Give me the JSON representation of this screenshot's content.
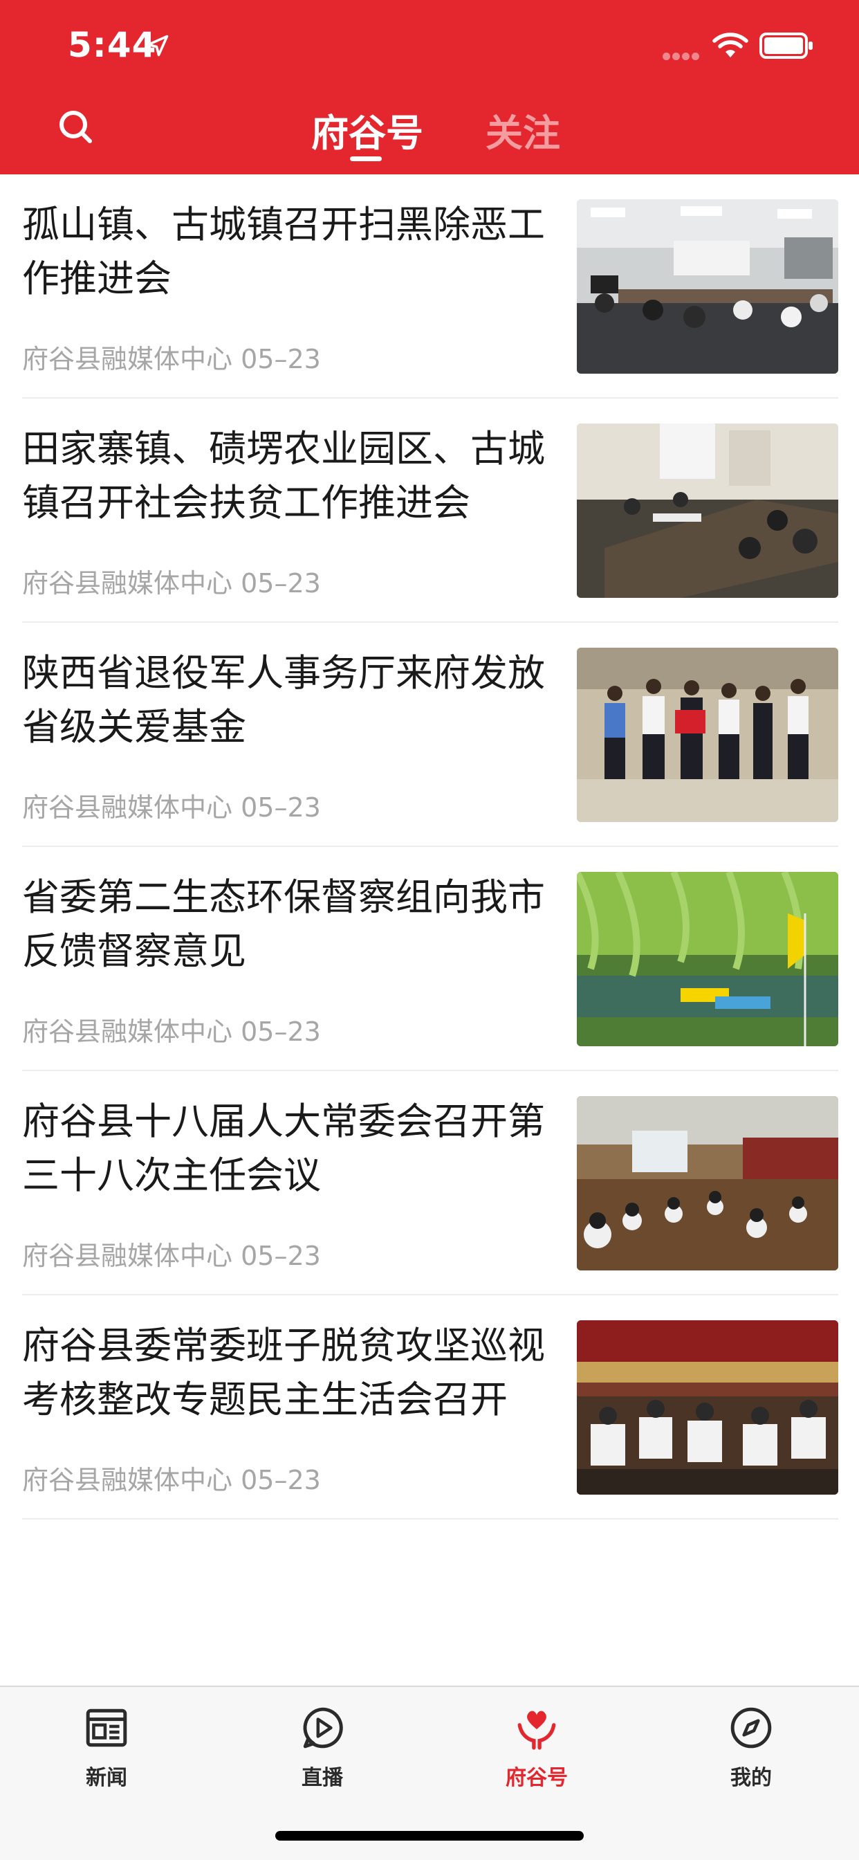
{
  "status_bar": {
    "time": "5:44"
  },
  "header": {
    "tabs": [
      {
        "label": "府谷号",
        "active": true
      },
      {
        "label": "关注",
        "active": false
      }
    ]
  },
  "news": [
    {
      "title": "孤山镇、古城镇召开扫黑除恶工作推进会",
      "source": "府谷县融媒体中心",
      "date": "05–23",
      "thumb": "meeting-room-photo"
    },
    {
      "title": "田家寨镇、碛塄农业园区、古城镇召开社会扶贫工作推进会",
      "source": "府谷县融媒体中心",
      "date": "05–23",
      "thumb": "meeting-table-photo"
    },
    {
      "title": "陕西省退役军人事务厅来府发放省级关爱基金",
      "source": "府谷县融媒体中心",
      "date": "05–23",
      "thumb": "group-photo"
    },
    {
      "title": "省委第二生态环保督察组向我市反馈督察意见",
      "source": "府谷县融媒体中心",
      "date": "05–23",
      "thumb": "lake-boats-photo"
    },
    {
      "title": "府谷县十八届人大常委会召开第三十八次主任会议",
      "source": "府谷县融媒体中心",
      "date": "05–23",
      "thumb": "conference-hall-photo"
    },
    {
      "title": "府谷县委常委班子脱贫攻坚巡视考核整改专题民主生活会召开",
      "source": "府谷县融媒体中心",
      "date": "05–23",
      "thumb": "auditorium-photo"
    }
  ],
  "tabbar": [
    {
      "label": "新闻",
      "icon": "newspaper-icon",
      "active": false
    },
    {
      "label": "直播",
      "icon": "play-bubble-icon",
      "active": false
    },
    {
      "label": "府谷号",
      "icon": "heart-hands-icon",
      "active": true
    },
    {
      "label": "我的",
      "icon": "compass-icon",
      "active": false
    }
  ],
  "colors": {
    "brand_red": "#e4262f",
    "meta_gray": "#a6a6a6"
  }
}
